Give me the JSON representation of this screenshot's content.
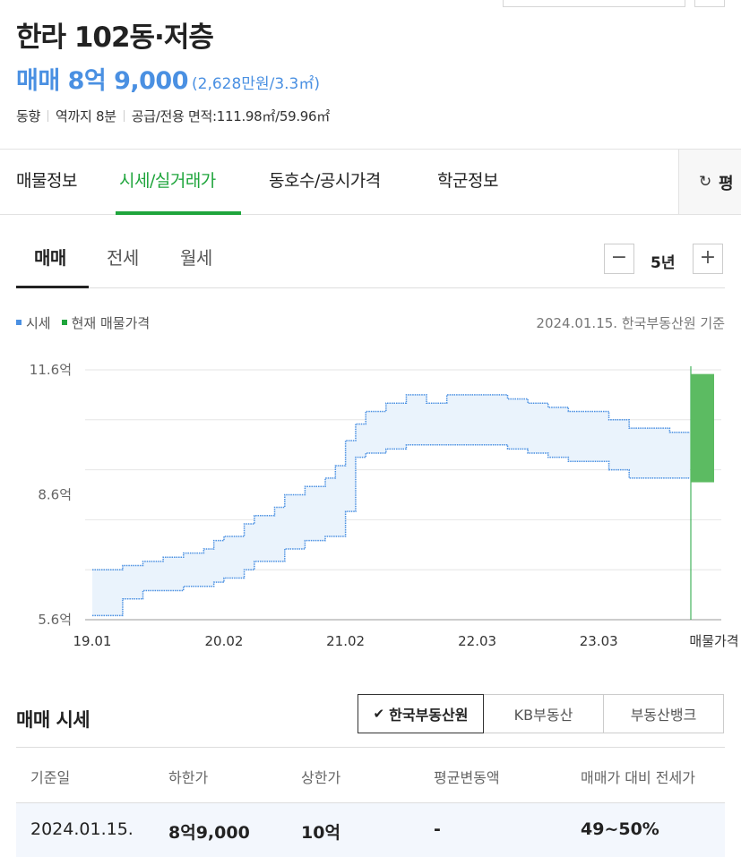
{
  "listing": {
    "title": "한라 102동·저층",
    "price_main": "매매 8억 9,000",
    "price_unit": "(2,628만원/3.3㎡)",
    "info": [
      "동향",
      "역까지 8분",
      "공급/전용 면적:111.98㎡/59.96㎡"
    ]
  },
  "main_tabs": {
    "tabs": [
      {
        "label": "매물정보"
      },
      {
        "label": "시세/실거래가"
      },
      {
        "label": "동호수/공시가격"
      },
      {
        "label": "학군정보"
      }
    ],
    "active_index": 1,
    "refresh_label": "평",
    "refresh_icon": "refresh-icon"
  },
  "sub_tabs": {
    "tabs": [
      {
        "label": "매매"
      },
      {
        "label": "전세"
      },
      {
        "label": "월세"
      }
    ],
    "active_index": 0,
    "period_label": "5년",
    "minus": "−",
    "plus": "+"
  },
  "legend": {
    "items": [
      {
        "label": "시세",
        "color": "#4a90e2"
      },
      {
        "label": "현재 매물가격",
        "color": "#1fa53c"
      }
    ],
    "basis": "2024.01.15. 한국부동산원 기준"
  },
  "chart_data": {
    "type": "area",
    "y_tick_labels": [
      "11.6억",
      "8.6억",
      "5.6억"
    ],
    "ylim": [
      5.6,
      11.6
    ],
    "x_tick_labels": [
      "19.01",
      "20.02",
      "21.02",
      "22.03",
      "23.03",
      "매물가격"
    ],
    "x_ticks": [
      "2019-01",
      "2020-02",
      "2021-02",
      "2022-03",
      "2023-03"
    ],
    "series": [
      {
        "name": "시세",
        "color": "#4a90e2",
        "x": [
          "2019-01",
          "2019-02",
          "2019-04",
          "2019-06",
          "2019-08",
          "2019-10",
          "2019-12",
          "2020-01",
          "2020-02",
          "2020-04",
          "2020-05",
          "2020-07",
          "2020-08",
          "2020-10",
          "2020-12",
          "2021-01",
          "2021-02",
          "2021-03",
          "2021-04",
          "2021-06",
          "2021-08",
          "2021-10",
          "2021-12",
          "2022-02",
          "2022-03",
          "2022-06",
          "2022-08",
          "2022-10",
          "2022-12",
          "2023-02",
          "2023-04",
          "2023-06",
          "2023-08",
          "2023-10",
          "2023-12"
        ],
        "upper": [
          6.8,
          6.8,
          6.9,
          7.0,
          7.1,
          7.2,
          7.3,
          7.5,
          7.6,
          7.9,
          8.1,
          8.3,
          8.6,
          8.8,
          9.0,
          9.3,
          9.9,
          10.3,
          10.6,
          10.8,
          11.0,
          10.8,
          11.0,
          11.0,
          11.0,
          10.9,
          10.8,
          10.7,
          10.6,
          10.6,
          10.4,
          10.2,
          10.2,
          10.1,
          10.1
        ],
        "lower": [
          5.7,
          5.7,
          6.1,
          6.3,
          6.3,
          6.4,
          6.4,
          6.5,
          6.6,
          6.8,
          7.0,
          7.0,
          7.3,
          7.5,
          7.6,
          7.6,
          8.2,
          9.5,
          9.6,
          9.7,
          9.8,
          9.8,
          9.8,
          9.8,
          9.8,
          9.7,
          9.6,
          9.5,
          9.4,
          9.4,
          9.2,
          9.0,
          9.0,
          9.0,
          9.0
        ]
      }
    ],
    "listing_price": {
      "name": "현재 매물가격",
      "color": "#1fa53c",
      "low": 8.9,
      "high": 11.5
    }
  },
  "market_section": {
    "title": "매매 시세",
    "sources": [
      {
        "label": "한국부동산원",
        "active": true,
        "check_icon": "check-icon"
      },
      {
        "label": "KB부동산",
        "active": false
      },
      {
        "label": "부동산뱅크",
        "active": false
      }
    ],
    "table": {
      "headers": [
        "기준일",
        "하한가",
        "상한가",
        "평균변동액",
        "매매가 대비 전세가"
      ],
      "rows": [
        [
          "2024.01.15.",
          "8억9,000",
          "10억",
          "-",
          "49~50%"
        ]
      ]
    }
  }
}
